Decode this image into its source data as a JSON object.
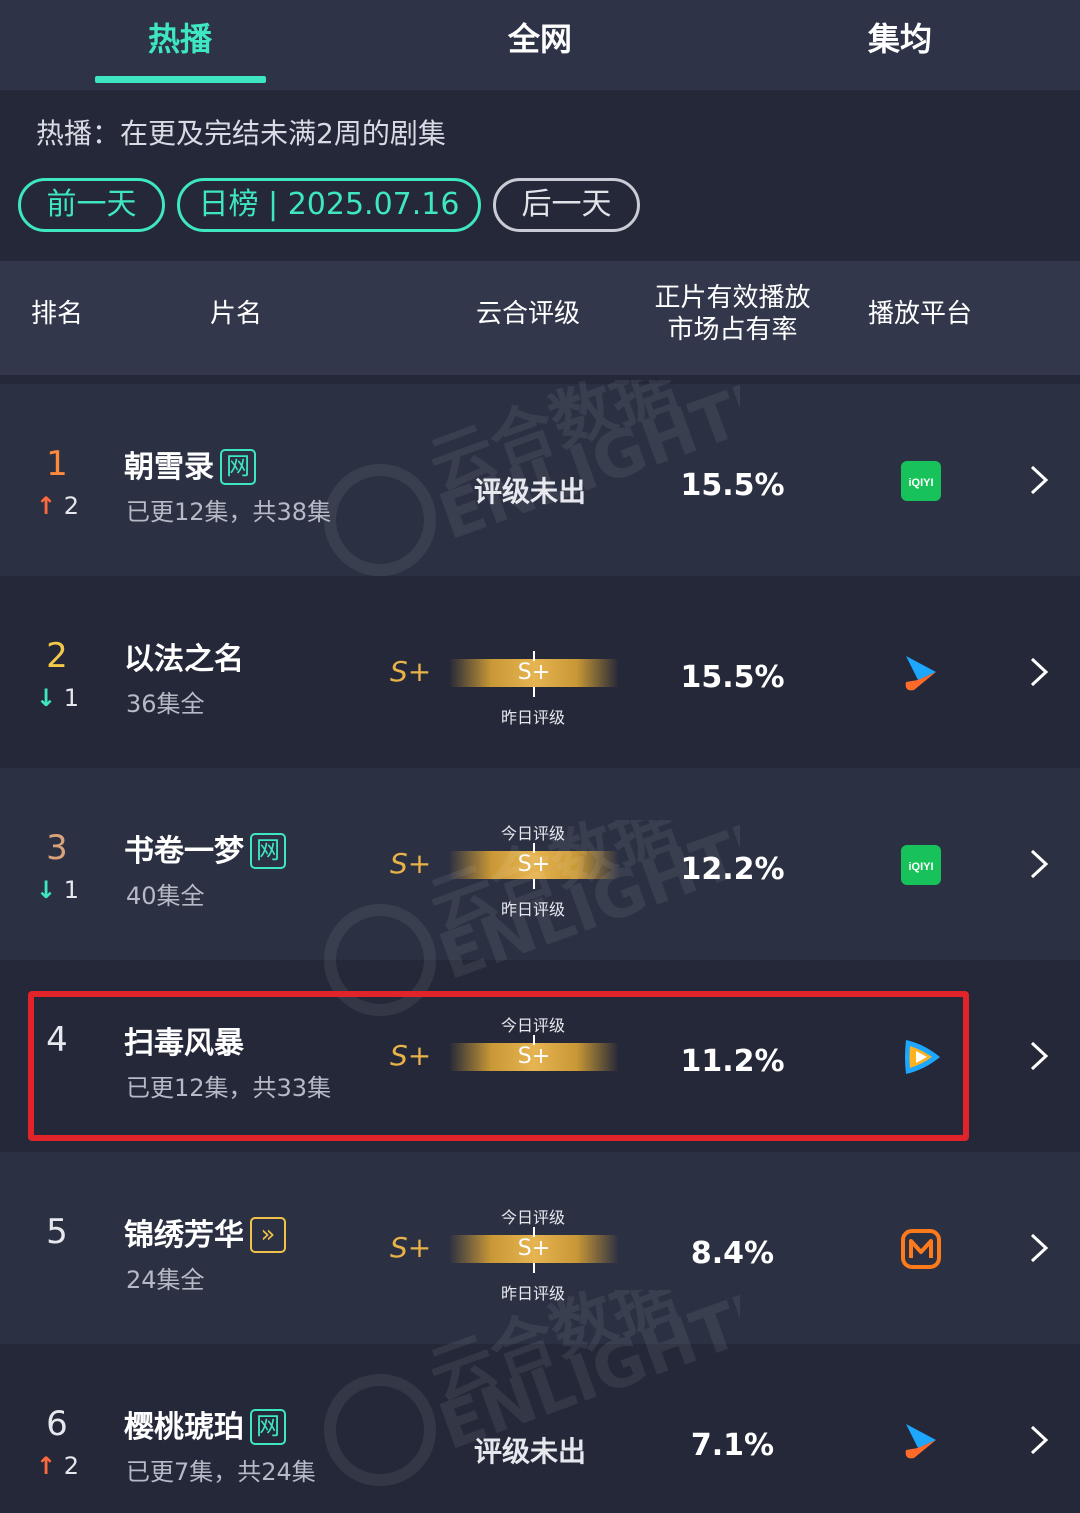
{
  "tabs": [
    {
      "label": "热播",
      "active": true
    },
    {
      "label": "全网",
      "active": false
    },
    {
      "label": "集均",
      "active": false
    }
  ],
  "description": "热播：在更及完结未满2周的剧集",
  "date_nav": {
    "prev": "前一天",
    "current": "日榜 | 2025.07.16",
    "next": "后一天"
  },
  "headers": {
    "rank": "排名",
    "title": "片名",
    "rating": "云合评级",
    "share_line1": "正片有效播放",
    "share_line2": "市场占有率",
    "platform": "播放平台"
  },
  "labels": {
    "today_rating": "今日评级",
    "yesterday_rating": "昨日评级",
    "no_rating": "评级未出"
  },
  "watermark": {
    "cn": "云合数据",
    "en": "ENLIGHTENT"
  },
  "rows": [
    {
      "rank": "1",
      "change_dir": "up",
      "change": "2",
      "title": "朝雪录",
      "badge": "网",
      "sub": "已更12集，共38集",
      "grade": "",
      "bar": "",
      "rating_text": "评级未出",
      "share": "15.5%",
      "platform": "iqiyi-icon",
      "platform_text": "iQIYI"
    },
    {
      "rank": "2",
      "change_dir": "down",
      "change": "1",
      "title": "以法之名",
      "badge": "",
      "sub": "36集全",
      "grade": "S+",
      "bar": "S+",
      "rating_text": "",
      "share": "15.5%",
      "platform": "youku-icon",
      "platform_text": ""
    },
    {
      "rank": "3",
      "change_dir": "down",
      "change": "1",
      "title": "书卷一梦",
      "badge": "网",
      "sub": "40集全",
      "grade": "S+",
      "bar": "S+",
      "rating_text": "",
      "share": "12.2%",
      "platform": "iqiyi-icon",
      "platform_text": "iQIYI"
    },
    {
      "rank": "4",
      "change_dir": "",
      "change": "",
      "title": "扫毒风暴",
      "badge": "",
      "sub": "已更12集，共33集",
      "grade": "S+",
      "bar": "S+",
      "rating_text": "",
      "share": "11.2%",
      "platform": "tencent-video-icon",
      "platform_text": ""
    },
    {
      "rank": "5",
      "change_dir": "",
      "change": "",
      "title": "锦绣芳华",
      "badge": "»",
      "sub": "24集全",
      "grade": "S+",
      "bar": "S+",
      "rating_text": "",
      "share": "8.4%",
      "platform": "mango-tv-icon",
      "platform_text": ""
    },
    {
      "rank": "6",
      "change_dir": "up",
      "change": "2",
      "title": "樱桃琥珀",
      "badge": "网",
      "sub": "已更7集，共24集",
      "grade": "",
      "bar": "",
      "rating_text": "评级未出",
      "share": "7.1%",
      "platform": "youku-icon",
      "platform_text": ""
    }
  ],
  "colors": {
    "accent": "#3ee6c1",
    "background": "#242838",
    "gold": "#e8b24a",
    "highlight": "#e0242a",
    "up": "#ff6a3d"
  }
}
